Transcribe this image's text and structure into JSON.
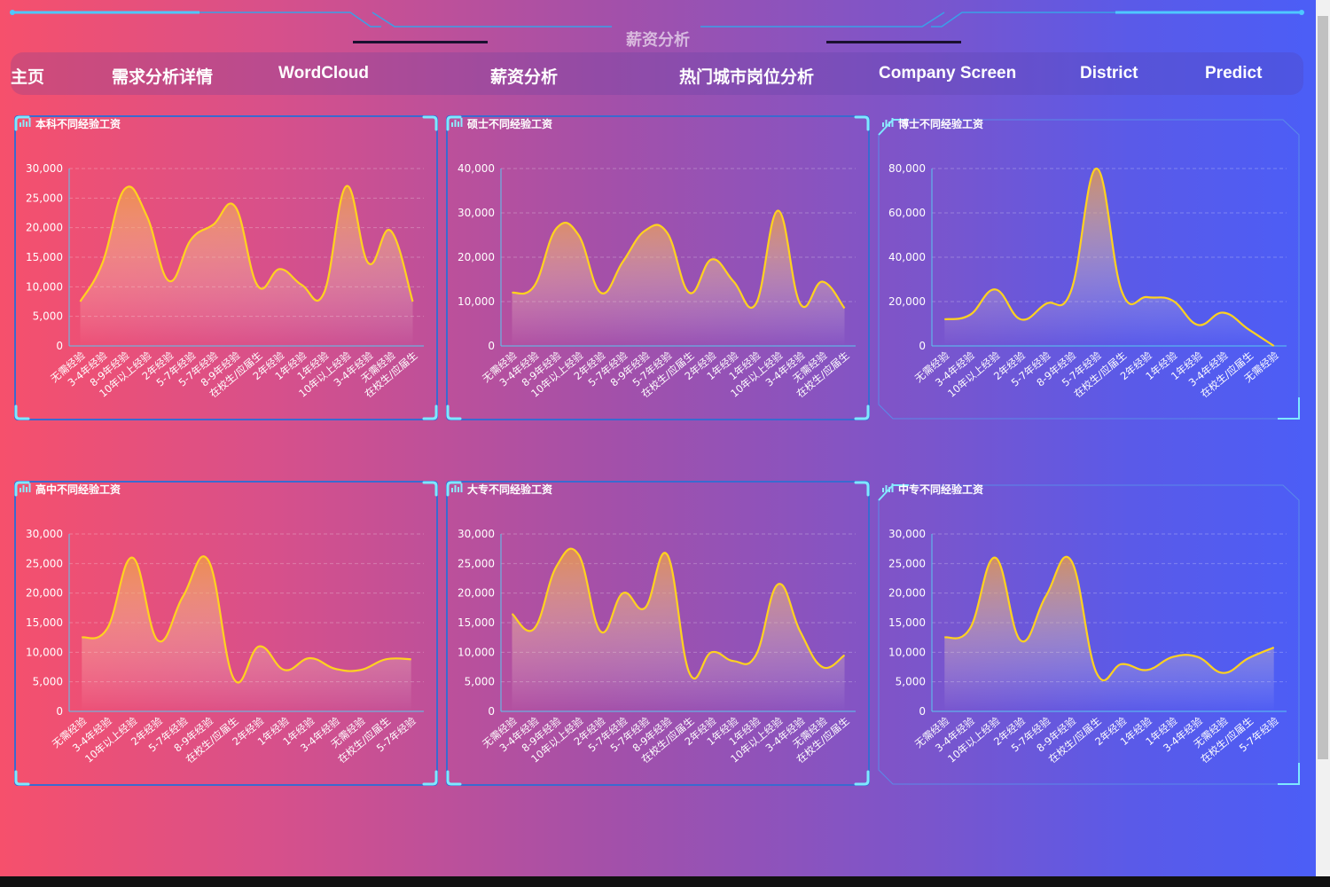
{
  "header": {
    "title": "薪资分析"
  },
  "nav": {
    "items": [
      {
        "label": "主页"
      },
      {
        "label": "需求分析详情"
      },
      {
        "label": "WordCloud"
      },
      {
        "label": "薪资分析"
      },
      {
        "label": "热门城市岗位分析"
      },
      {
        "label": "Company Screen"
      },
      {
        "label": "District"
      },
      {
        "label": "Predict"
      }
    ]
  },
  "colors": {
    "line": "#ffd21f",
    "area_top": "#f0a040",
    "frame_corner": "#7ee8ff",
    "frame_edge": "#3a6ad0"
  },
  "chart_data": [
    {
      "type": "area",
      "title": "本科不同经验工资",
      "ylim": [
        0,
        30000
      ],
      "yticks": [
        "0",
        "5,000",
        "10,000",
        "15,000",
        "20,000",
        "25,000",
        "30,000"
      ],
      "categories": [
        "无需经验",
        "3-4年经验",
        "8-9年经验",
        "10年以上经验",
        "2年经验",
        "5-7年经验",
        "5-7年经验",
        "8-9年经验",
        "在校生/应届生",
        "2年经验",
        "1年经验",
        "1年经验",
        "10年以上经验",
        "3-4年经验",
        "无需经验",
        "在校生/应届生"
      ],
      "values": [
        7500,
        14000,
        26500,
        22000,
        11000,
        18000,
        20500,
        23500,
        10200,
        13000,
        10300,
        9000,
        27000,
        14000,
        19500,
        7500
      ]
    },
    {
      "type": "area",
      "title": "硕士不同经验工资",
      "ylim": [
        0,
        40000
      ],
      "yticks": [
        "0",
        "10,000",
        "20,000",
        "30,000",
        "40,000"
      ],
      "categories": [
        "无需经验",
        "3-4年经验",
        "8-9年经验",
        "10年以上经验",
        "2年经验",
        "5-7年经验",
        "8-9年经验",
        "5-7年经验",
        "在校生/应届生",
        "2年经验",
        "1年经验",
        "1年经验",
        "10年以上经验",
        "3-4年经验",
        "无需经验",
        "在校生/应届生"
      ],
      "values": [
        12000,
        13500,
        26500,
        25000,
        12000,
        19000,
        26000,
        25500,
        12000,
        19500,
        14500,
        9500,
        30500,
        9500,
        14500,
        8500
      ]
    },
    {
      "type": "area",
      "title": "博士不同经验工资",
      "ylim": [
        0,
        80000
      ],
      "yticks": [
        "0",
        "20,000",
        "40,000",
        "60,000",
        "80,000"
      ],
      "categories": [
        "无需经验",
        "3-4年经验",
        "10年以上经验",
        "2年经验",
        "5-7年经验",
        "8-9年经验",
        "5-7年经验",
        "在校生/应届生",
        "2年经验",
        "1年经验",
        "1年经验",
        "3-4年经验",
        "在校生/应届生",
        "无需经验"
      ],
      "values": [
        12000,
        14000,
        25500,
        12000,
        19000,
        25000,
        80000,
        24500,
        22000,
        20500,
        9500,
        15000,
        7500,
        0
      ]
    },
    {
      "type": "area",
      "title": "高中不同经验工资",
      "ylim": [
        0,
        30000
      ],
      "yticks": [
        "0",
        "5,000",
        "10,000",
        "15,000",
        "20,000",
        "25,000",
        "30,000"
      ],
      "categories": [
        "无需经验",
        "3-4年经验",
        "10年以上经验",
        "2年经验",
        "5-7年经验",
        "8-9年经验",
        "在校生/应届生",
        "2年经验",
        "1年经验",
        "1年经验",
        "3-4年经验",
        "无需经验",
        "在校生/应届生",
        "5-7年经验"
      ],
      "values": [
        12500,
        14000,
        26000,
        12000,
        19500,
        25500,
        5500,
        11000,
        7000,
        9000,
        7200,
        7000,
        8800,
        8800
      ]
    },
    {
      "type": "area",
      "title": "大专不同经验工资",
      "ylim": [
        0,
        30000
      ],
      "yticks": [
        "0",
        "5,000",
        "10,000",
        "15,000",
        "20,000",
        "25,000",
        "30,000"
      ],
      "categories": [
        "无需经验",
        "3-4年经验",
        "8-9年经验",
        "10年以上经验",
        "2年经验",
        "5-7年经验",
        "5-7年经验",
        "8-9年经验",
        "在校生/应届生",
        "2年经验",
        "1年经验",
        "1年经验",
        "10年以上经验",
        "3-4年经验",
        "无需经验",
        "在校生/应届生"
      ],
      "values": [
        16500,
        14000,
        24500,
        26500,
        13500,
        20000,
        17500,
        26500,
        6500,
        10000,
        8500,
        9500,
        21500,
        13500,
        7500,
        9500
      ]
    },
    {
      "type": "area",
      "title": "中专不同经验工资",
      "ylim": [
        0,
        30000
      ],
      "yticks": [
        "0",
        "5,000",
        "10,000",
        "15,000",
        "20,000",
        "25,000",
        "30,000"
      ],
      "categories": [
        "无需经验",
        "3-4年经验",
        "10年以上经验",
        "2年经验",
        "5-7年经验",
        "8-9年经验",
        "在校生/应届生",
        "2年经验",
        "1年经验",
        "1年经验",
        "3-4年经验",
        "无需经验",
        "在校生/应届生",
        "5-7年经验"
      ],
      "values": [
        12500,
        14000,
        26000,
        12000,
        19500,
        25500,
        6500,
        8000,
        7000,
        9200,
        9200,
        6500,
        9000,
        10800
      ]
    }
  ]
}
